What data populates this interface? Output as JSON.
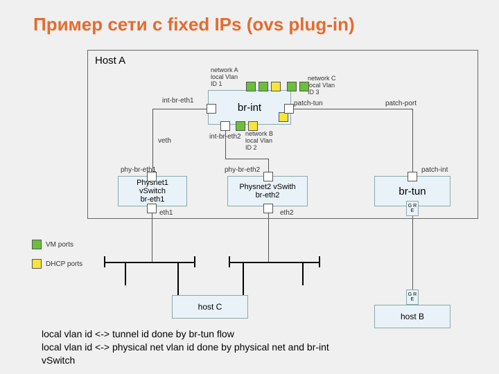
{
  "title": "Пример сети с fixed IPs (ovs plug-in)",
  "host_a": "Host A",
  "switches": {
    "brint": "br-int",
    "physnet1_l1": "Physnet1",
    "physnet1_l2": "vSwitch",
    "physnet1_l3": "br-eth1",
    "physnet2_l1": "Physnet2 vSwith",
    "physnet2_l2": "br-eth2",
    "brtun": "br-tun"
  },
  "hosts": {
    "b": "host B",
    "c": "host C"
  },
  "vlans": {
    "a_l1": "network A",
    "a_l2": "local Vlan",
    "a_l3": "ID 1",
    "b_l1": "network B",
    "b_l2": "local Vlan",
    "b_l3": "ID 2",
    "c_l1": "network C",
    "c_l2": "local Vlan",
    "c_l3": "ID 3"
  },
  "labels": {
    "int_br_eth1": "int-br-eth1",
    "int_br_eth2": "int-br-eth2",
    "veth": "veth",
    "phy_br_eth1": "phy-br-eth1",
    "phy_br_eth2": "phy-br-eth2",
    "eth1": "eth1",
    "eth2": "eth2",
    "patch_tun": "patch-tun",
    "patch_port": "patch-port",
    "patch_int": "patch-int"
  },
  "legend": {
    "vm": "VM ports",
    "dhcp": "DHCP ports"
  },
  "gre": "G\nR\nE",
  "footer": {
    "l1": "local vlan id <-> tunnel id done by br-tun flow",
    "l2": "local vlan id <-> physical net vlan id done by physical net and br-int",
    "l3": "vSwitch"
  }
}
